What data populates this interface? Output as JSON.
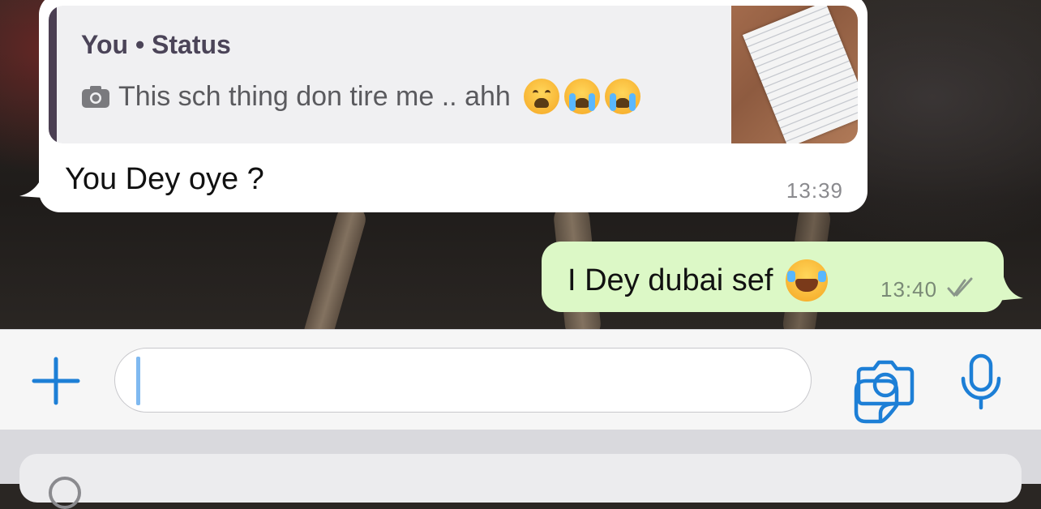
{
  "conversation": {
    "incoming": {
      "reply_to": {
        "author": "You • Status",
        "text": "This sch thing don tire me .. ahh",
        "emojis": [
          "weary-face",
          "loudly-crying-face",
          "loudly-crying-face"
        ],
        "media_icon": "camera-icon"
      },
      "text": "You Dey oye ?",
      "time": "13:39"
    },
    "outgoing": {
      "text": "I Dey dubai sef",
      "emoji": "face-with-tears-of-joy",
      "time": "13:40",
      "status_icon": "double-check-icon"
    }
  },
  "composer": {
    "value": "",
    "icons": [
      "plus-icon",
      "sticker-icon",
      "camera-icon",
      "microphone-icon"
    ]
  },
  "colors": {
    "accent": "#1d7fd6",
    "outgoing_bubble": "#dcf8c6",
    "incoming_bubble": "#ffffff",
    "quote_bar": "#4b3f52"
  }
}
